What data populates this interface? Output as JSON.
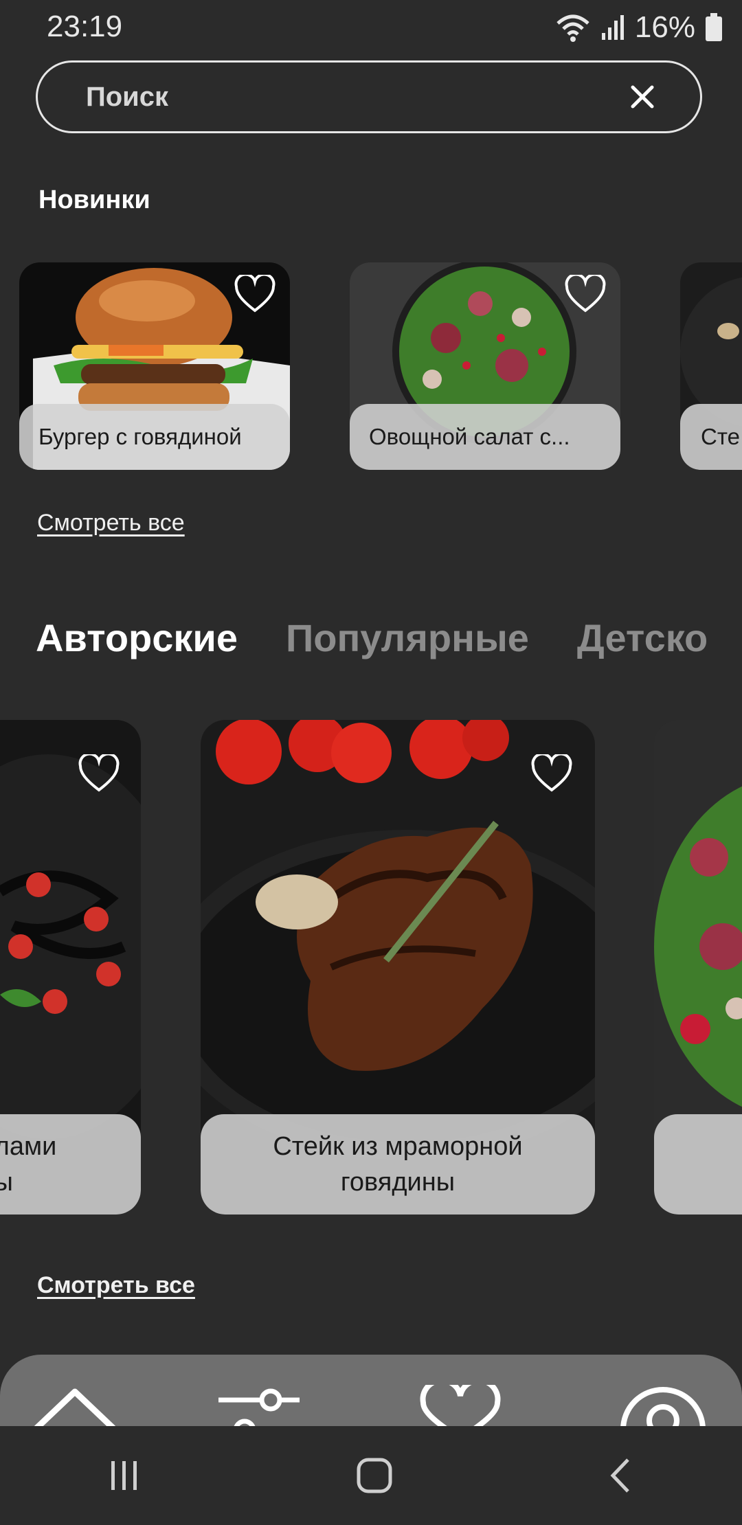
{
  "status_bar": {
    "time": "23:19",
    "battery": "16%"
  },
  "search": {
    "placeholder": "Поиск"
  },
  "new_section": {
    "title": "Новинки",
    "items": [
      {
        "name": "Бургер с говядиной"
      },
      {
        "name": "Овощной салат с..."
      },
      {
        "name": "Сте"
      }
    ],
    "see_all": "Смотреть все"
  },
  "tabs": [
    "Авторские",
    "Популярные",
    "Детско"
  ],
  "featured": {
    "items": [
      {
        "name": "...лами\n...ы"
      },
      {
        "name": "Стейк из мраморной говядины"
      },
      {
        "name": ""
      }
    ],
    "see_all": "Смотреть все"
  },
  "bottom_nav": [
    "home-icon",
    "filter-icon",
    "heart-icon",
    "profile-icon"
  ],
  "system_nav": [
    "recents-icon",
    "home-circle-icon",
    "back-icon"
  ]
}
